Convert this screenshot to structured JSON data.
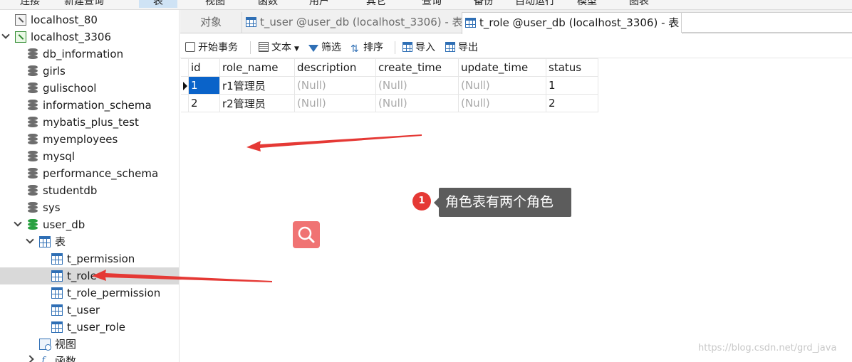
{
  "menu": {
    "items": [
      "连接",
      "新建查询",
      "表",
      "视图",
      "函数",
      "用户",
      "其它",
      "查询",
      "备份",
      "自动运行",
      "模型",
      "图表"
    ]
  },
  "sidebar": {
    "items": [
      {
        "label": "localhost_80",
        "icon": "connection-icon"
      },
      {
        "label": "localhost_3306",
        "icon": "connection-active-icon"
      },
      {
        "label": "db_information",
        "icon": "database-icon"
      },
      {
        "label": "girls",
        "icon": "database-icon"
      },
      {
        "label": "gulischool",
        "icon": "database-icon"
      },
      {
        "label": "information_schema",
        "icon": "database-icon"
      },
      {
        "label": "mybatis_plus_test",
        "icon": "database-icon"
      },
      {
        "label": "myemployees",
        "icon": "database-icon"
      },
      {
        "label": "mysql",
        "icon": "database-icon"
      },
      {
        "label": "performance_schema",
        "icon": "database-icon"
      },
      {
        "label": "studentdb",
        "icon": "database-icon"
      },
      {
        "label": "sys",
        "icon": "database-icon"
      },
      {
        "label": "user_db",
        "icon": "database-open-icon"
      },
      {
        "label": "表",
        "icon": "tables-folder-icon"
      },
      {
        "label": "t_permission",
        "icon": "table-icon"
      },
      {
        "label": "t_role",
        "icon": "table-icon"
      },
      {
        "label": "t_role_permission",
        "icon": "table-icon"
      },
      {
        "label": "t_user",
        "icon": "table-icon"
      },
      {
        "label": "t_user_role",
        "icon": "table-icon"
      },
      {
        "label": "视图",
        "icon": "views-icon"
      },
      {
        "label": "函数",
        "icon": "function-icon"
      }
    ]
  },
  "tabs": [
    {
      "label": "对象"
    },
    {
      "label": "t_user @user_db (localhost_3306) - 表"
    },
    {
      "label": "t_role @user_db (localhost_3306) - 表"
    }
  ],
  "toolbar": {
    "begin_tx": "开始事务",
    "text": "文本",
    "filter": "筛选",
    "sort": "排序",
    "import": "导入",
    "export": "导出"
  },
  "grid": {
    "columns": [
      "id",
      "role_name",
      "description",
      "create_time",
      "update_time",
      "status"
    ],
    "rows": [
      [
        "1",
        "r1管理员",
        "(Null)",
        "(Null)",
        "(Null)",
        "1"
      ],
      [
        "2",
        "r2管理员",
        "(Null)",
        "(Null)",
        "(Null)",
        "2"
      ]
    ]
  },
  "annotation": {
    "number": "1",
    "text": "角色表有两个角色"
  },
  "watermark": "https://blog.csdn.net/grd_java",
  "colors": {
    "selection": "#0a63c9",
    "callout_bg": "#5c5c5c",
    "arrow": "#e53935",
    "db_active": "#27a040"
  }
}
